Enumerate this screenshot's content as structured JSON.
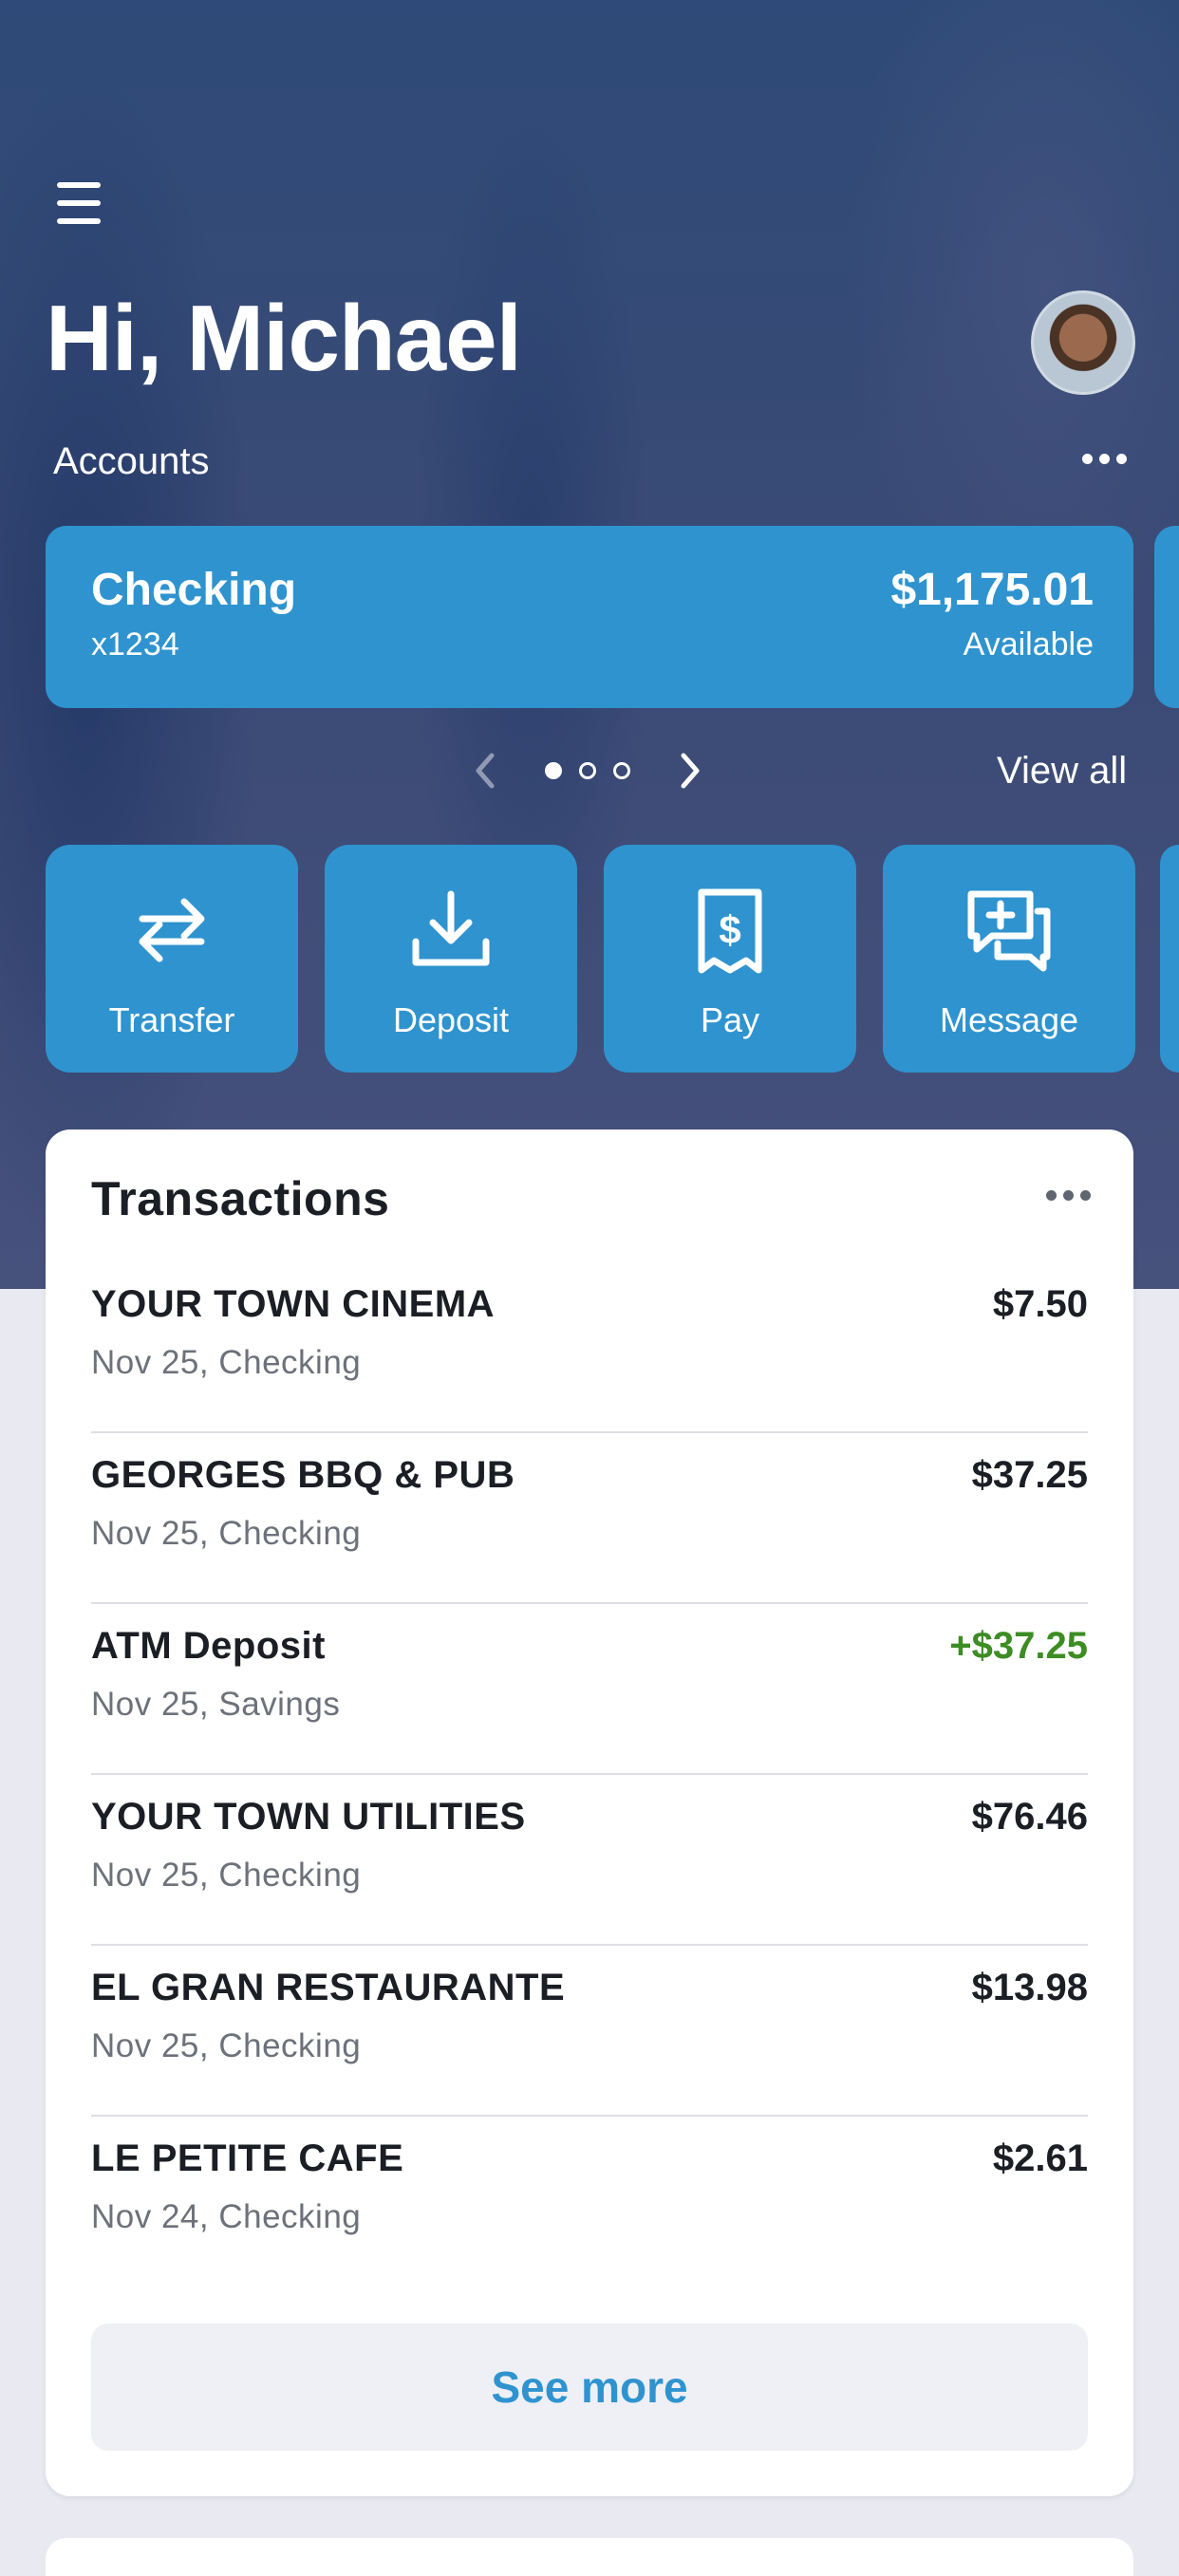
{
  "header": {
    "greeting": "Hi, Michael",
    "accounts_label": "Accounts"
  },
  "account_card": {
    "name": "Checking",
    "number": "x1234",
    "balance": "$1,175.01",
    "balance_label": "Available"
  },
  "pager": {
    "total_pages": 3,
    "current_page": 1,
    "view_all_label": "View all"
  },
  "actions": [
    {
      "label": "Transfer",
      "icon": "transfer-icon"
    },
    {
      "label": "Deposit",
      "icon": "deposit-icon"
    },
    {
      "label": "Pay",
      "icon": "pay-icon"
    },
    {
      "label": "Message",
      "icon": "message-icon"
    }
  ],
  "transactions": {
    "title": "Transactions",
    "items": [
      {
        "name": "YOUR TOWN CINEMA",
        "sub": "Nov 25, Checking",
        "amount": "$7.50",
        "credit": false
      },
      {
        "name": "GEORGES BBQ & PUB",
        "sub": "Nov 25, Checking",
        "amount": "$37.25",
        "credit": false
      },
      {
        "name": "ATM Deposit",
        "sub": "Nov 25, Savings",
        "amount": "+$37.25",
        "credit": true
      },
      {
        "name": "YOUR TOWN UTILITIES",
        "sub": "Nov 25, Checking",
        "amount": "$76.46",
        "credit": false
      },
      {
        "name": "EL GRAN RESTAURANTE",
        "sub": "Nov 25, Checking",
        "amount": "$13.98",
        "credit": false
      },
      {
        "name": "LE PETITE CAFE",
        "sub": "Nov 24, Checking",
        "amount": "$2.61",
        "credit": false
      }
    ],
    "see_more_label": "See more"
  },
  "colors": {
    "accent": "#2f93cf",
    "credit": "#3d8c24"
  }
}
